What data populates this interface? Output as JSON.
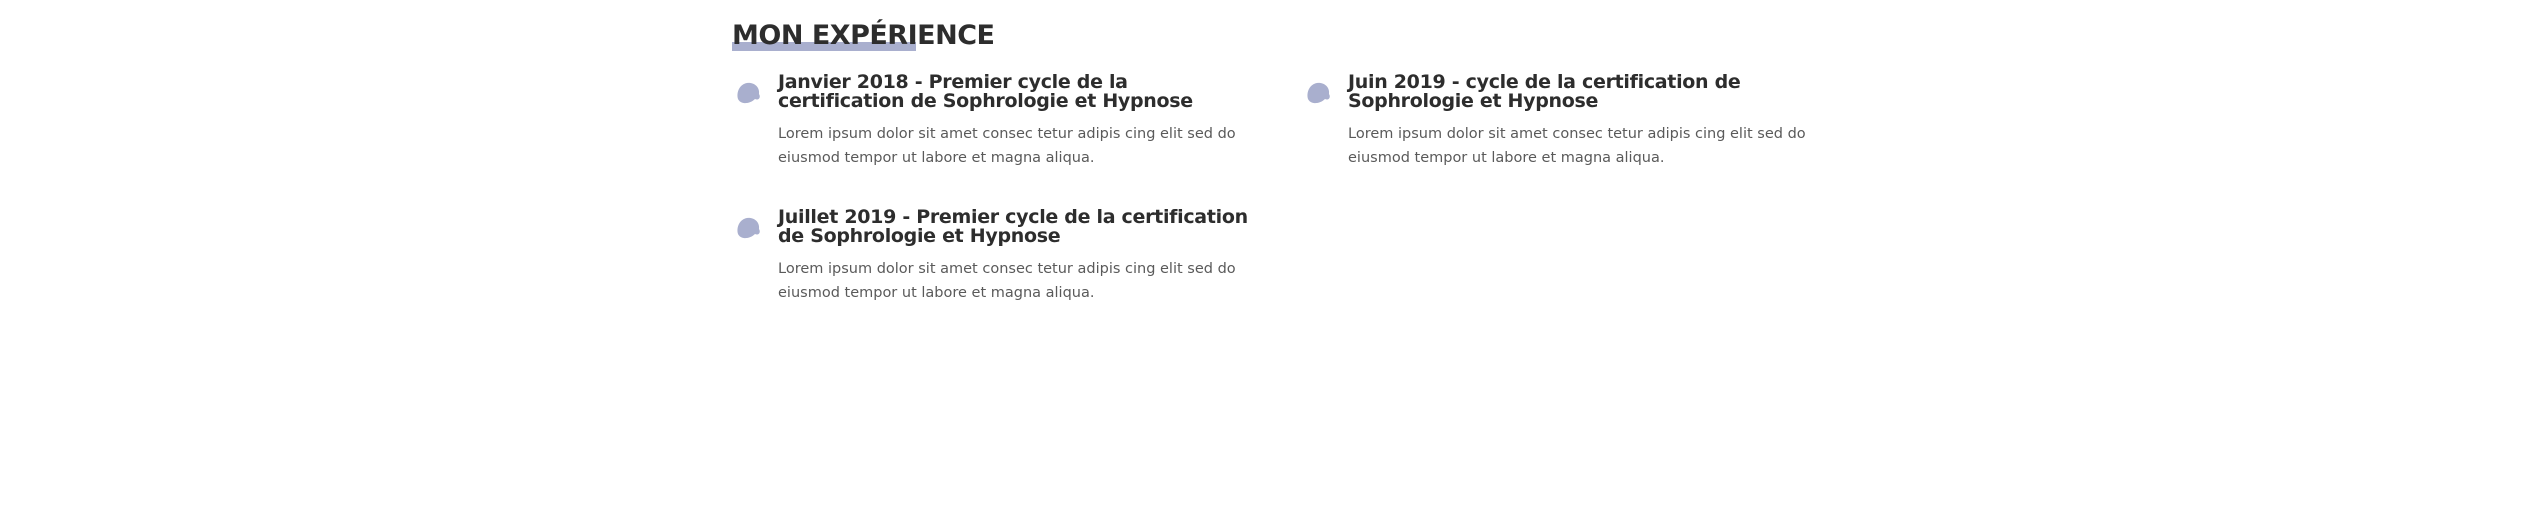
{
  "section": {
    "title": "MON EXPÉRIENCE"
  },
  "accent_color": "#a9afce",
  "experience": [
    {
      "title": "Janvier 2018 - Premier cycle de la certification de Sophrologie et Hypnose",
      "text": "Lorem ipsum dolor sit amet consec tetur adipis cing elit sed do eiusmod tempor ut labore et magna aliqua.",
      "icon": "blob-bullet-icon"
    },
    {
      "title": "Juin 2019 - cycle de la certification de Sophrologie et Hypnose",
      "text": "Lorem ipsum dolor sit amet consec tetur adipis cing elit sed do eiusmod tempor ut labore et magna aliqua.",
      "icon": "blob-bullet-icon"
    },
    {
      "title": "Juillet 2019 - Premier cycle de la certification de Sophrologie et Hypnose",
      "text": "Lorem ipsum dolor sit amet consec tetur adipis cing elit sed do eiusmod tempor ut labore et magna aliqua.",
      "icon": "blob-bullet-icon"
    }
  ]
}
